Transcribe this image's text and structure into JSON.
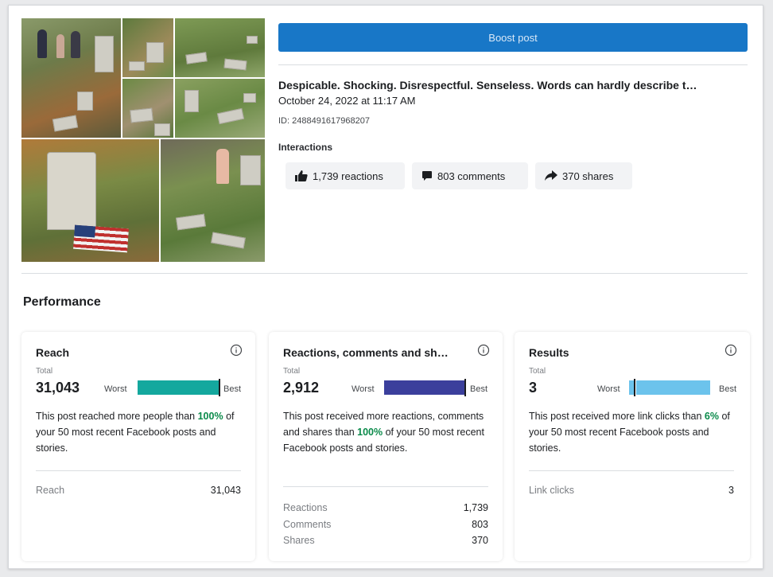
{
  "boost_button": "Boost post",
  "post": {
    "title": "Despicable. Shocking. Disrespectful. Senseless. Words can hardly describe t…",
    "date": "October 24, 2022 at 11:17 AM",
    "id": "ID: 2488491617968207",
    "interactions_label": "Interactions",
    "reactions": "1,739 reactions",
    "comments": "803 comments",
    "shares": "370 shares"
  },
  "performance": {
    "title": "Performance",
    "cards": [
      {
        "title": "Reach",
        "total_label": "Total",
        "total": "31,043",
        "worst": "Worst",
        "best": "Best",
        "bar_fraction": 1.0,
        "bar_color": "#14a89e",
        "desc_pre": "This post reached more people than ",
        "desc_pct": "100%",
        "desc_post": " of your 50 most recent Facebook posts and stories.",
        "metrics": [
          {
            "label": "Reach",
            "value": "31,043"
          }
        ]
      },
      {
        "title": "Reactions, comments and sh…",
        "total_label": "Total",
        "total": "2,912",
        "worst": "Worst",
        "best": "Best",
        "bar_fraction": 1.0,
        "bar_color": "#3b3f9c",
        "desc_pre": "This post received more reactions, comments and shares than ",
        "desc_pct": "100%",
        "desc_post": " of your 50 most recent Facebook posts and stories.",
        "metrics": [
          {
            "label": "Reactions",
            "value": "1,739"
          },
          {
            "label": "Comments",
            "value": "803"
          },
          {
            "label": "Shares",
            "value": "370"
          }
        ]
      },
      {
        "title": "Results",
        "total_label": "Total",
        "total": "3",
        "worst": "Worst",
        "best": "Best",
        "bar_fraction": 0.06,
        "bar_color": "#6cc3ec",
        "desc_pre": "This post received more link clicks than ",
        "desc_pct": "6%",
        "desc_post": " of your 50 most recent Facebook posts and stories.",
        "metrics": [
          {
            "label": "Link clicks",
            "value": "3"
          }
        ]
      }
    ]
  }
}
